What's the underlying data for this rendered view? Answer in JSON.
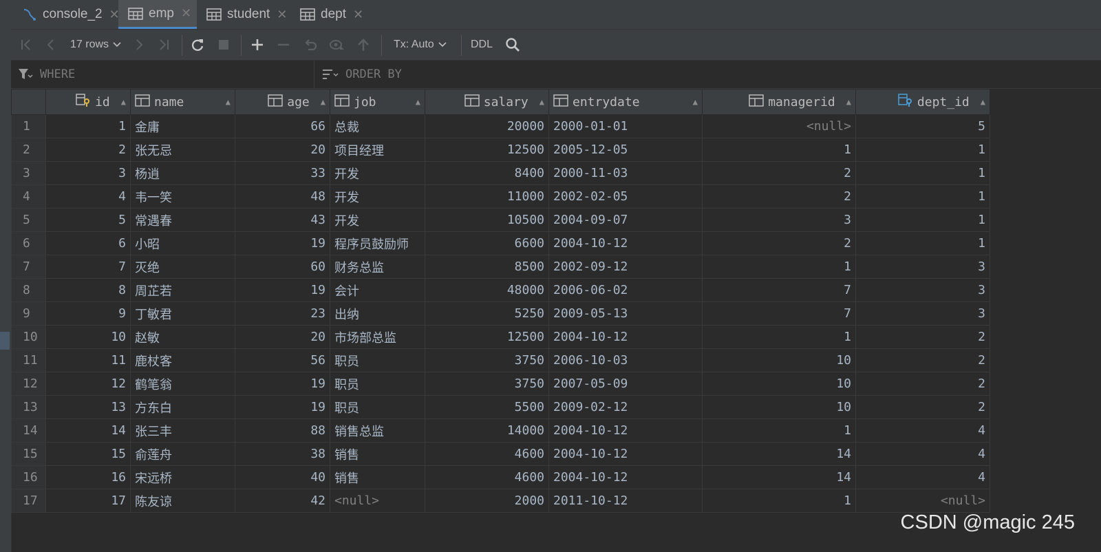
{
  "tabs": [
    {
      "label": "console_2",
      "icon": "console-icon",
      "active": false
    },
    {
      "label": "emp",
      "icon": "table-icon",
      "active": true
    },
    {
      "label": "student",
      "icon": "table-icon",
      "active": false
    },
    {
      "label": "dept",
      "icon": "table-icon",
      "active": false
    }
  ],
  "toolbar": {
    "rows_label": "17 rows",
    "tx_label": "Tx: Auto",
    "ddl_label": "DDL"
  },
  "filter": {
    "where_label": "WHERE",
    "order_label": "ORDER BY"
  },
  "columns": [
    "id",
    "name",
    "age",
    "job",
    "salary",
    "entrydate",
    "managerid",
    "dept_id"
  ],
  "rows": [
    [
      "1",
      "1",
      "金庸",
      "66",
      "总裁",
      "20000",
      "2000-01-01",
      "<null>",
      "5"
    ],
    [
      "2",
      "2",
      "张无忌",
      "20",
      "项目经理",
      "12500",
      "2005-12-05",
      "1",
      "1"
    ],
    [
      "3",
      "3",
      "杨逍",
      "33",
      "开发",
      "8400",
      "2000-11-03",
      "2",
      "1"
    ],
    [
      "4",
      "4",
      "韦一笑",
      "48",
      "开发",
      "11000",
      "2002-02-05",
      "2",
      "1"
    ],
    [
      "5",
      "5",
      "常遇春",
      "43",
      "开发",
      "10500",
      "2004-09-07",
      "3",
      "1"
    ],
    [
      "6",
      "6",
      "小昭",
      "19",
      "程序员鼓励师",
      "6600",
      "2004-10-12",
      "2",
      "1"
    ],
    [
      "7",
      "7",
      "灭绝",
      "60",
      "财务总监",
      "8500",
      "2002-09-12",
      "1",
      "3"
    ],
    [
      "8",
      "8",
      "周芷若",
      "19",
      "会计",
      "48000",
      "2006-06-02",
      "7",
      "3"
    ],
    [
      "9",
      "9",
      "丁敏君",
      "23",
      "出纳",
      "5250",
      "2009-05-13",
      "7",
      "3"
    ],
    [
      "10",
      "10",
      "赵敏",
      "20",
      "市场部总监",
      "12500",
      "2004-10-12",
      "1",
      "2"
    ],
    [
      "11",
      "11",
      "鹿杖客",
      "56",
      "职员",
      "3750",
      "2006-10-03",
      "10",
      "2"
    ],
    [
      "12",
      "12",
      "鹤笔翁",
      "19",
      "职员",
      "3750",
      "2007-05-09",
      "10",
      "2"
    ],
    [
      "13",
      "13",
      "方东白",
      "19",
      "职员",
      "5500",
      "2009-02-12",
      "10",
      "2"
    ],
    [
      "14",
      "14",
      "张三丰",
      "88",
      "销售总监",
      "14000",
      "2004-10-12",
      "1",
      "4"
    ],
    [
      "15",
      "15",
      "俞莲舟",
      "38",
      "销售",
      "4600",
      "2004-10-12",
      "14",
      "4"
    ],
    [
      "16",
      "16",
      "宋远桥",
      "40",
      "销售",
      "4600",
      "2004-10-12",
      "14",
      "4"
    ],
    [
      "17",
      "17",
      "陈友谅",
      "42",
      "<null>",
      "2000",
      "2011-10-12",
      "1",
      "<null>"
    ]
  ],
  "watermark": "CSDN @magic 245",
  "colors": {
    "accent": "#4a88c7",
    "background": "#2b2b2b",
    "header": "#3c3f41"
  }
}
